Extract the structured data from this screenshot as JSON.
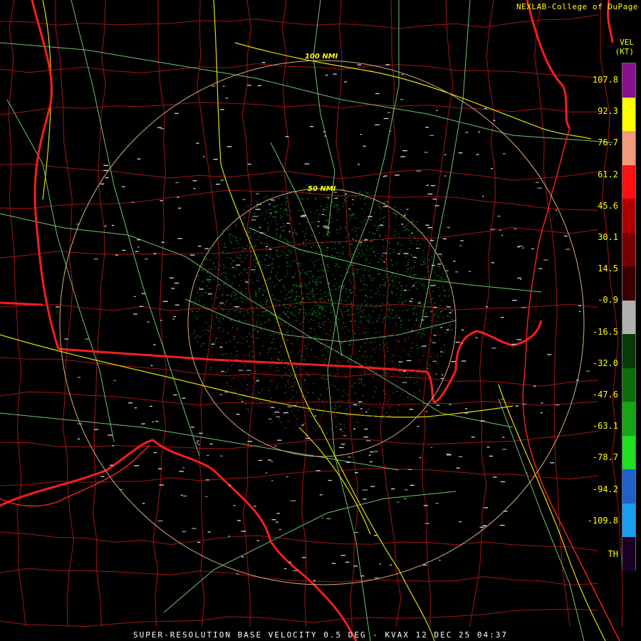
{
  "header": {
    "credit": "NEXLAB-College of DuPage"
  },
  "footer": {
    "product_line": "SUPER-RESOLUTION BASE VELOCITY 0.5 DEG - KVAX 12 DEC 25 04:37"
  },
  "radar": {
    "site": "KVAX",
    "range_rings": [
      {
        "label": "50 NMI",
        "nmi": 50
      },
      {
        "label": "100 NMI",
        "nmi": 100
      }
    ]
  },
  "legend": {
    "title_line1": "VEL",
    "title_line2": "(KT)",
    "labels": [
      "107.8",
      "92.3",
      "76.7",
      "61.2",
      "45.6",
      "30.1",
      "14.5",
      "-0.9",
      "-16.5",
      "-32.0",
      "-47.6",
      "-63.1",
      "-78.7",
      "-94.2",
      "-109.8",
      "TH"
    ],
    "colors": [
      "#8a0f8f",
      "#fffe00",
      "#f49a7a",
      "#ff1010",
      "#b00000",
      "#7a0000",
      "#3a0000",
      "#b0b0b0",
      "#083a08",
      "#0b6e0b",
      "#15a515",
      "#20e020",
      "#2060c8",
      "#1a9cf0",
      "#180020"
    ]
  },
  "map_colors": {
    "state_border": "#ff1a1a",
    "county_border": "#b01818",
    "highway": "#7ed37e",
    "interstate": "#e6e600",
    "range_ring": "#d8b07a"
  }
}
